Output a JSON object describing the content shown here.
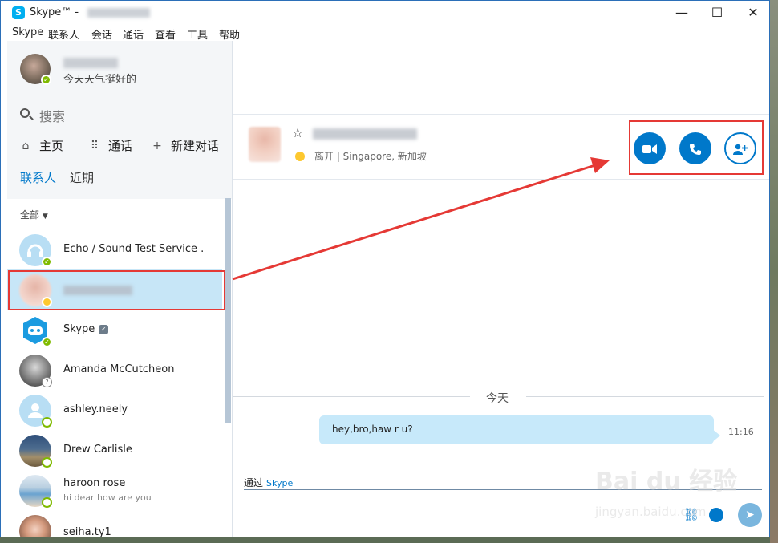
{
  "window": {
    "title": "Skype™ - ",
    "minimize_glyph": "—",
    "maximize_glyph": "☐",
    "close_glyph": "✕"
  },
  "menu": [
    "Skype",
    "联系人",
    "会话",
    "通话",
    "查看",
    "工具",
    "帮助"
  ],
  "profile": {
    "mood": "今天天气挺好的"
  },
  "search": {
    "placeholder": "搜索"
  },
  "nav": {
    "home": "主页",
    "calls": "通话",
    "new_chat": "新建对话"
  },
  "tabs": {
    "contacts": "联系人",
    "recent": "近期"
  },
  "filter": {
    "label": "全部"
  },
  "contacts": [
    {
      "name": "Echo / Sound Test Service .",
      "sub": "",
      "status": "online"
    },
    {
      "name": "",
      "sub": "",
      "status": "away"
    },
    {
      "name": "Skype",
      "sub": "",
      "status": "online"
    },
    {
      "name": "Amanda McCutcheon",
      "sub": "",
      "status": "unknown"
    },
    {
      "name": "ashley.neely",
      "sub": "",
      "status": "offline"
    },
    {
      "name": "Drew Carlisle",
      "sub": "",
      "status": "offline"
    },
    {
      "name": "haroon rose",
      "sub": "hi dear how are you",
      "status": "offline"
    },
    {
      "name": "seiha.ty1",
      "sub": "",
      "status": "offline"
    }
  ],
  "conversation": {
    "status": "离开 | Singapore, 新加坡",
    "date_separator": "今天",
    "messages": [
      {
        "text": "hey,bro,haw r u?",
        "time": "11:16"
      }
    ],
    "via_label": "通过",
    "via_service": "Skype"
  },
  "watermark": {
    "main": "Bai du 经验",
    "sub": "jingyan.baidu.com"
  },
  "colors": {
    "accent": "#0078ca",
    "annotation": "#e53935",
    "online": "#7fba00",
    "away": "#fdc82f"
  }
}
